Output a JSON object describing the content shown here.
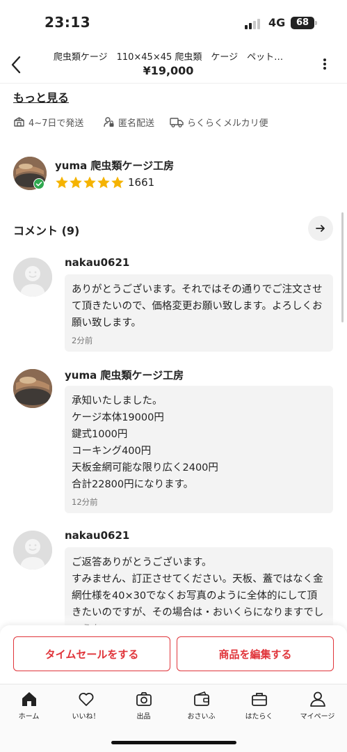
{
  "status_bar": {
    "time": "23:13",
    "network": "4G",
    "battery": "68"
  },
  "header": {
    "title": "爬虫類ケージ　110×45×45 爬虫類　ケージ　ペット…",
    "price": "¥19,000"
  },
  "see_more": "もっと見る",
  "shipping": [
    {
      "icon": "package-icon",
      "text": "4~7日で発送"
    },
    {
      "icon": "anonymous-user-icon",
      "text": "匿名配送"
    },
    {
      "icon": "truck-icon",
      "text": "らくらくメルカリ便"
    }
  ],
  "seller": {
    "name": "yuma 爬虫類ケージ工房",
    "rating": 5,
    "rating_count": "1661"
  },
  "comments_section": {
    "title": "コメント (9)"
  },
  "comments": [
    {
      "user": "nakau0621",
      "avatar": "default",
      "text": "ありがとうございます。それではその通りでご注文させて頂きたいので、価格変更お願い致します。よろしくお願い致します。",
      "time": "2分前"
    },
    {
      "user": "yuma 爬虫類ケージ工房",
      "avatar": "photo",
      "text": "承知いたしました。\nケージ本体19000円\n鍵式1000円\nコーキング400円\n天板金網可能な限り広く2400円\n合計22800円になります。",
      "time": "12分前"
    },
    {
      "user": "nakau0621",
      "avatar": "default",
      "text": "ご返答ありがとうございます。\nすみません、訂正させてください。天板、蓋ではなく金網仕様を40×30でなくお写真のように全体的にして頂きたいのですが、その場合は・おいくらになりますでしょうか",
      "time": ""
    }
  ],
  "actions": {
    "time_sale": "タイムセールをする",
    "edit_item": "商品を編集する"
  },
  "tabs": [
    {
      "label": "ホーム",
      "icon": "home-icon",
      "active": true
    },
    {
      "label": "いいね！",
      "icon": "heart-icon",
      "active": false
    },
    {
      "label": "出品",
      "icon": "camera-icon",
      "active": false
    },
    {
      "label": "おさいふ",
      "icon": "wallet-icon",
      "active": false
    },
    {
      "label": "はたらく",
      "icon": "briefcase-icon",
      "active": false
    },
    {
      "label": "マイページ",
      "icon": "person-icon",
      "active": false
    }
  ],
  "colors": {
    "accent": "#e0343a",
    "star": "#f5b301",
    "verified": "#2fa84f"
  }
}
